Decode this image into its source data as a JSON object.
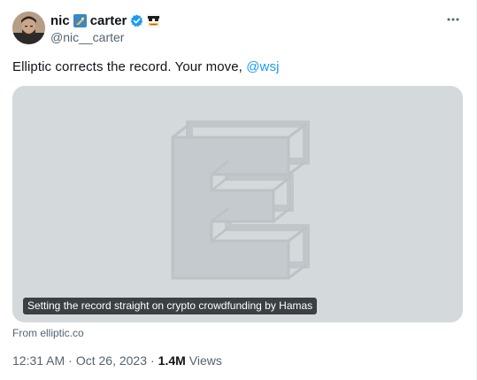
{
  "author": {
    "name_first": "nic",
    "name_last": "carter",
    "handle": "@nic__carter",
    "icons": [
      "rocket-emoji-icon",
      "verified-badge-icon",
      "pixel-glasses-icon"
    ]
  },
  "tweet": {
    "text_prefix": "Elliptic corrects the record. Your move, ",
    "mention": "@wsj"
  },
  "card": {
    "caption": "Setting the record straight on crypto crowdfunding by Hamas",
    "source": "From elliptic.co",
    "logo_icon": "elliptic-logo-icon"
  },
  "meta": {
    "time": "12:31 AM",
    "separator1": "·",
    "date": "Oct 26, 2023",
    "separator2": "·",
    "views_count": "1.4M",
    "views_label": "Views"
  },
  "colors": {
    "accent": "#1d9bf0",
    "secondary_text": "#536471",
    "card_bg": "#d4d9dc"
  }
}
